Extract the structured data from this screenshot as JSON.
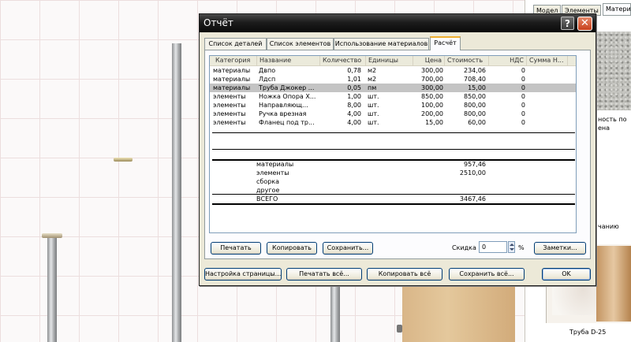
{
  "dialog": {
    "title": "Отчёт",
    "help_glyph": "?",
    "close_glyph": "✕",
    "tabs": [
      {
        "label": "Список деталей"
      },
      {
        "label": "Список элементов"
      },
      {
        "label": "Использование материалов"
      },
      {
        "label": "Расчёт"
      }
    ],
    "active_tab": "Расчёт",
    "columns": [
      "Категория",
      "Название",
      "Количество",
      "Единицы",
      "Цена",
      "Стоимость",
      "НДС",
      "Сумма Н..."
    ],
    "rows": [
      {
        "category": "материалы",
        "name": "Двпо",
        "qty": "0,78",
        "unit": "м2",
        "price": "300,00",
        "cost": "234,06",
        "vat": "0"
      },
      {
        "category": "материалы",
        "name": "Лдсп",
        "qty": "1,01",
        "unit": "м2",
        "price": "700,00",
        "cost": "708,40",
        "vat": "0"
      },
      {
        "category": "материалы",
        "name": "Труба Джокер ...",
        "qty": "0,05",
        "unit": "пм",
        "price": "300,00",
        "cost": "15,00",
        "vat": "0"
      },
      {
        "category": "элементы",
        "name": "Ножка Опора Х...",
        "qty": "1,00",
        "unit": "шт.",
        "price": "850,00",
        "cost": "850,00",
        "vat": "0"
      },
      {
        "category": "элементы",
        "name": "Направляющ...",
        "qty": "8,00",
        "unit": "шт.",
        "price": "100,00",
        "cost": "800,00",
        "vat": "0"
      },
      {
        "category": "элементы",
        "name": "Ручка врезная",
        "qty": "4,00",
        "unit": "шт.",
        "price": "200,00",
        "cost": "800,00",
        "vat": "0"
      },
      {
        "category": "элементы",
        "name": "Фланец под тр...",
        "qty": "4,00",
        "unit": "шт.",
        "price": "15,00",
        "cost": "60,00",
        "vat": "0"
      }
    ],
    "selected_row": 2,
    "summary": [
      {
        "label": "материалы",
        "value": "957,46"
      },
      {
        "label": "элементы",
        "value": "2510,00"
      },
      {
        "label": "сборка",
        "value": ""
      },
      {
        "label": "другое",
        "value": ""
      }
    ],
    "total": {
      "label": "ВСЕГО",
      "value": "3467,46"
    },
    "buttons": {
      "print": "Печатать",
      "copy": "Копировать",
      "save": "Сохранить...",
      "notes": "Заметки...",
      "page_setup": "Настройка страницы...",
      "print_all": "Печатать всё...",
      "copy_all": "Копировать всё",
      "save_all": "Сохранить всё...",
      "ok": "OK"
    },
    "discount": {
      "label": "Скидка",
      "value": "0",
      "unit": "%"
    }
  },
  "side_panel": {
    "tabs": [
      "Модел",
      "Элементы",
      "Матери"
    ],
    "text_ostatok": "ность по",
    "text_ostatok2": "ена",
    "text_default": "чанию",
    "thumb_caption": "Труба D-25"
  }
}
